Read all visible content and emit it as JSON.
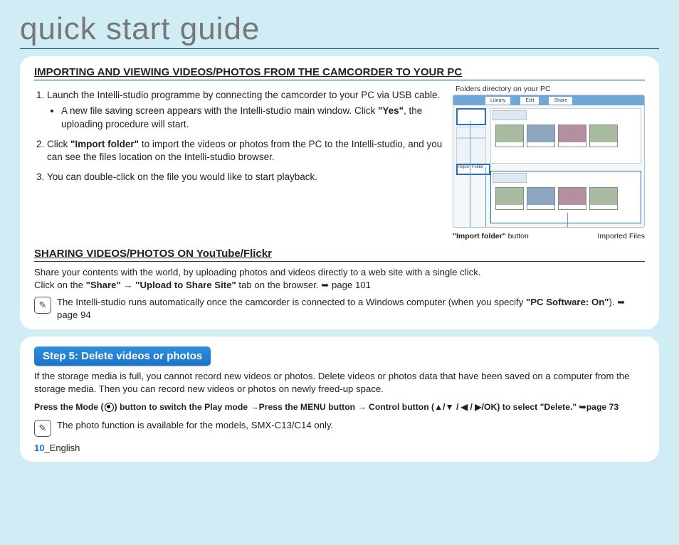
{
  "title": "quick start guide",
  "sec1": {
    "heading": "IMPORTING AND VIEWING VIDEOS/PHOTOS FROM THE CAMCORDER TO YOUR PC",
    "step1_a": "Launch the Intelli-studio programme by connecting the camcorder to your PC via USB cable.",
    "step1_bullet_pre": "A new file saving screen appears with the Intelli-studio main window. Click ",
    "step1_bullet_yes": "\"Yes\"",
    "step1_bullet_post": ", the uploading procedure will start.",
    "step2_pre": "Click ",
    "step2_bold": "\"Import folder\"",
    "step2_post": " to import the videos or photos from the PC to the Intelli-studio, and you can see the files location on the Intelli-studio browser.",
    "step3": "You can double-click on the file you would like to start playback."
  },
  "figure": {
    "caption_top": "Folders directory on your PC",
    "caption_left_bold": "\"Import folder\"",
    "caption_left_rest": " button",
    "caption_right": "Imported Files",
    "tab1": "Library",
    "tab2": "Edit",
    "tab3": "Share",
    "import_btn": "Import Folder"
  },
  "sec2": {
    "heading": "SHARING VIDEOS/PHOTOS ON YouTube/Flickr",
    "p1": "Share your contents with the world, by uploading photos and videos directly to a web site with a single click.",
    "p2_pre": "Click on the ",
    "p2_b1": "\"Share\" → \"Upload to Share Site\"",
    "p2_post": " tab on the browser. ➥ page 101",
    "note_pre": "The Intelli-studio runs automatically once the camcorder is connected to a Windows computer (when you specify ",
    "note_b": "\"PC Software: On\"",
    "note_post": "). ➥ page 94"
  },
  "step5": {
    "badge": "Step 5:  Delete videos or photos",
    "intro": "If the storage media is full, you cannot record new videos or photos. Delete videos or photos data that have been saved on a computer from the storage media. Then you can record new videos or photos on newly freed-up space.",
    "instr_pre": "Press the Mode (",
    "instr_mid": ") button to switch the Play mode →Press the MENU button → Control button (▲/▼ / ◀ / ▶/OK) to select \"Delete.\"  ➥page 73",
    "note": "The photo function is available for the models, SMX-C13/C14 only."
  },
  "footer": {
    "page": "10",
    "sep": "_",
    "lang": "English"
  }
}
